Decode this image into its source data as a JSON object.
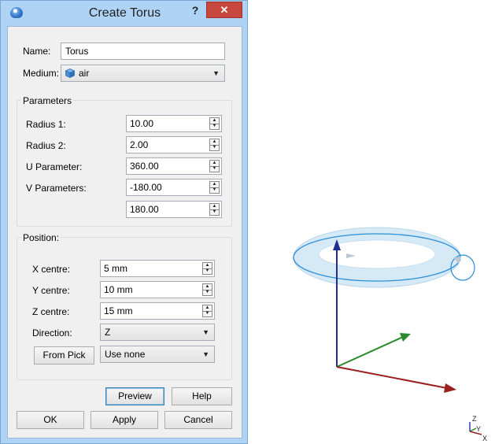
{
  "dialog": {
    "title": "Create Torus",
    "help_symbol": "?",
    "close_symbol": "✕",
    "name": {
      "label": "Name:",
      "value": "Torus"
    },
    "medium": {
      "label": "Medium:",
      "value": "air",
      "icon": "cube-icon"
    },
    "parameters": {
      "title": "Parameters",
      "radius1": {
        "label": "Radius 1:",
        "value": "10.00"
      },
      "radius2": {
        "label": "Radius 2:",
        "value": "2.00"
      },
      "u_param": {
        "label": "U Parameter:",
        "value": "360.00"
      },
      "v_param": {
        "label": "V Parameters:",
        "value_min": "-180.00",
        "value_max": "180.00"
      }
    },
    "position": {
      "title": "Position:",
      "x": {
        "label": "X centre:",
        "value": "5 mm"
      },
      "y": {
        "label": "Y centre:",
        "value": "10 mm"
      },
      "z": {
        "label": "Z centre:",
        "value": "15 mm"
      },
      "direction": {
        "label": "Direction:",
        "value": "Z"
      },
      "from_pick": {
        "label": "From Pick",
        "value": "Use none"
      }
    },
    "buttons": {
      "preview": "Preview",
      "help": "Help",
      "ok": "OK",
      "apply": "Apply",
      "cancel": "Cancel"
    }
  },
  "viewport": {
    "triad": {
      "z": "Z",
      "y": "Y",
      "x": "X"
    },
    "colors": {
      "torus_fill": "#d6e9f6",
      "torus_line": "#2c8fd8",
      "axis_z": "#1f2f8f",
      "axis_y": "#2a8a2a",
      "axis_x": "#9a1f1f"
    }
  }
}
